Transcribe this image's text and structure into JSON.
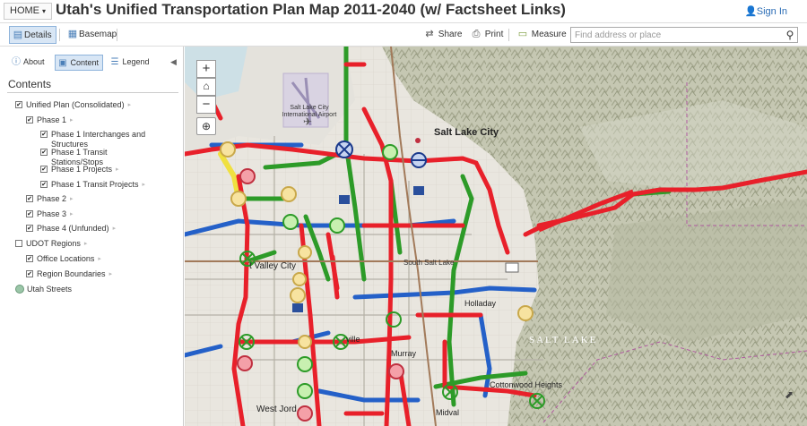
{
  "header": {
    "home_label": "HOME",
    "title": "Utah's Unified Transportation Plan Map 2011-2040 (w/ Factsheet Links)",
    "sign_in": "Sign In"
  },
  "toolbar": {
    "details": "Details",
    "basemap": "Basemap",
    "share": "Share",
    "print": "Print",
    "measure": "Measure",
    "search_placeholder": "Find address or place"
  },
  "panel": {
    "tabs": {
      "about": "About",
      "content": "Content",
      "legend": "Legend"
    },
    "heading": "Contents",
    "layers": [
      {
        "label": "Unified Plan (Consolidated)",
        "checked": true
      },
      {
        "label": "Phase 1",
        "checked": true
      },
      {
        "label": "Phase 1 Interchanges and",
        "label2": "Structures",
        "checked": true
      },
      {
        "label": "Phase 1 Transit",
        "label2": "Stations/Stops",
        "checked": true
      },
      {
        "label": "Phase 1 Projects",
        "checked": true
      },
      {
        "label": "Phase 1 Transit Projects",
        "checked": true
      },
      {
        "label": "Phase 2",
        "checked": true
      },
      {
        "label": "Phase 3",
        "checked": true
      },
      {
        "label": "Phase 4 (Unfunded)",
        "checked": true
      },
      {
        "label": "UDOT Regions",
        "checked": false
      },
      {
        "label": "Office Locations",
        "checked": true
      },
      {
        "label": "Region Boundaries",
        "checked": true
      },
      {
        "label": "Utah Streets"
      }
    ]
  },
  "map": {
    "zoom_in": "+",
    "zoom_out": "−",
    "labels": {
      "salt_lake_city": "Salt Lake City",
      "airport": "Salt Lake City International Airport",
      "south_salt_lake": "South Salt Lake",
      "valley_city": "t Valley City",
      "holladay": "Holladay",
      "murray": "Murray",
      "ville": "ville",
      "cottonwood_heights": "Cottonwood Heights",
      "midvale": "Midval",
      "west_jordan": "West Jord",
      "salt_lake_county": "SALT LAKE"
    },
    "colors": {
      "phase1": "#e8202a",
      "phase2": "#2d9b28",
      "phase3": "#2460c8",
      "phase4": "#f0e040",
      "station_fill_pink": "#f4a0a8",
      "station_fill_green": "#c8f0b0",
      "station_fill_yellow": "#f7e3a0"
    }
  }
}
